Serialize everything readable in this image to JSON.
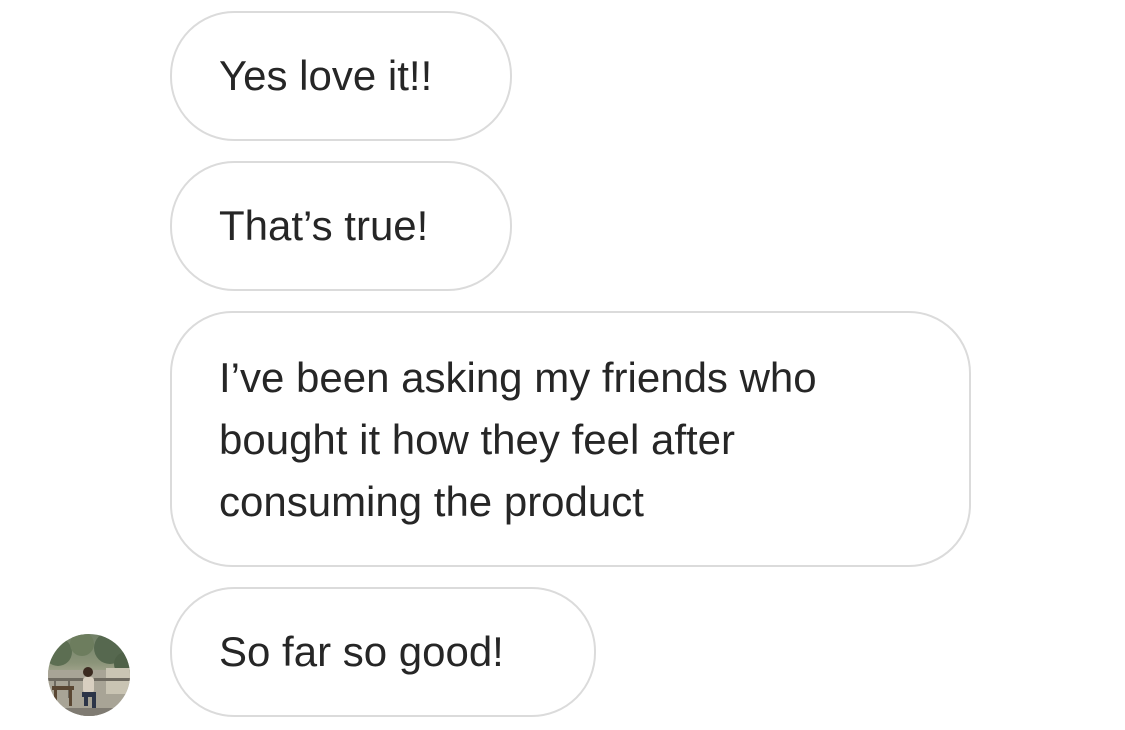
{
  "messages": [
    {
      "text": "Yes love it!!"
    },
    {
      "text": "That’s true!"
    },
    {
      "text": "I’ve been asking my friends who bought it how they feel after consuming the product"
    },
    {
      "text": "So far so good!"
    }
  ],
  "avatar": {
    "icon": "profile-photo"
  },
  "colors": {
    "bubble_border": "#dbdbdb",
    "text": "#262626",
    "background": "#ffffff"
  }
}
